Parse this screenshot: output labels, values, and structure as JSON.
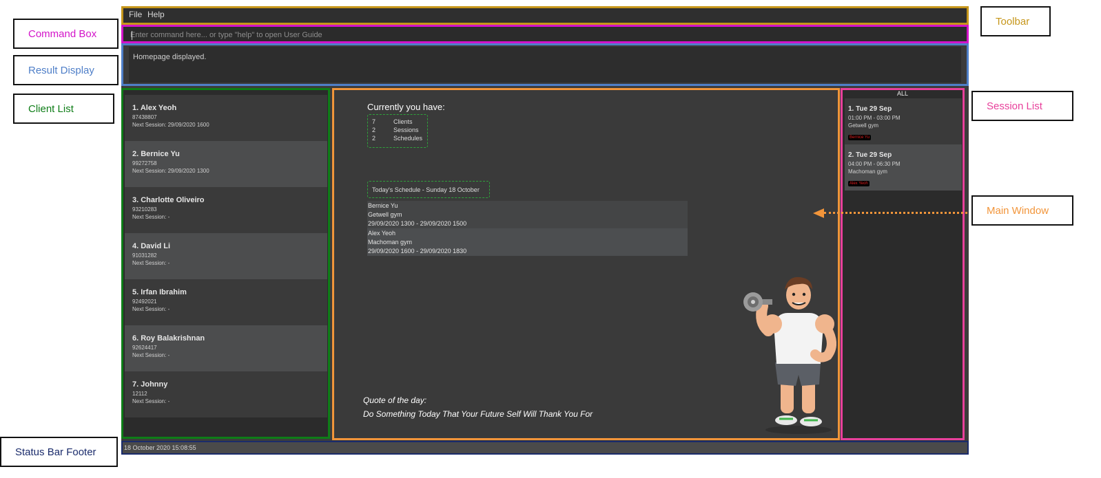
{
  "toolbar": {
    "menu": [
      "File",
      "Help"
    ]
  },
  "command_box": {
    "placeholder": "Enter command here... or type \"help\" to open User Guide",
    "value": ""
  },
  "result_display": {
    "text": "Homepage displayed."
  },
  "client_list": {
    "items": [
      {
        "name": "1.  Alex Yeoh",
        "phone": "87438807",
        "next": "Next Session: 29/09/2020 1600"
      },
      {
        "name": "2.  Bernice Yu",
        "phone": "99272758",
        "next": "Next Session: 29/09/2020 1300"
      },
      {
        "name": "3.  Charlotte Oliveiro",
        "phone": "93210283",
        "next": "Next Session:  -"
      },
      {
        "name": "4.  David Li",
        "phone": "91031282",
        "next": "Next Session:  -"
      },
      {
        "name": "5.  Irfan Ibrahim",
        "phone": "92492021",
        "next": "Next Session:  -"
      },
      {
        "name": "6.  Roy Balakrishnan",
        "phone": "92624417",
        "next": "Next Session:  -"
      },
      {
        "name": "7.  Johnny",
        "phone": "12112",
        "next": "Next Session:  -"
      }
    ]
  },
  "main_window": {
    "summary_title": "Currently you have:",
    "summary": [
      {
        "count": "7",
        "label": "Clients"
      },
      {
        "count": "2",
        "label": "Sessions"
      },
      {
        "count": "2",
        "label": "Schedules"
      }
    ],
    "schedule_title": "Today's Schedule - Sunday 18 October",
    "schedules": [
      {
        "client": "Bernice Yu",
        "gym": "Getwell gym",
        "time": "29/09/2020 1300 - 29/09/2020 1500"
      },
      {
        "client": "Alex Yeoh",
        "gym": "Machoman gym",
        "time": "29/09/2020 1600 - 29/09/2020 1830"
      }
    ],
    "quote_title": "Quote of the day:",
    "quote_text": "Do Something Today That Your Future Self Will Thank You For"
  },
  "session_list": {
    "filter": "ALL",
    "items": [
      {
        "title": "1.  Tue 29 Sep",
        "time": "01:00 PM - 03:00 PM",
        "gym": "Getwell gym",
        "client_tag": "Bernice Yu"
      },
      {
        "title": "2.  Tue 29 Sep",
        "time": "04:00 PM - 06:30 PM",
        "gym": "Machoman gym",
        "client_tag": "Alex Yeoh"
      }
    ]
  },
  "status_bar": {
    "text": "18 October 2020 15:08:55"
  },
  "annotations": {
    "toolbar": "Toolbar",
    "command_box": "Command Box",
    "result_display": "Result Display",
    "client_list": "Client List",
    "session_list": "Session List",
    "main_window": "Main Window",
    "status_bar": "Status Bar Footer"
  },
  "colors": {
    "toolbar": "#c6961a",
    "command_box": "#d313c9",
    "result_display": "#4f7fc8",
    "client_list": "#0e7d17",
    "main_window": "#f2953a",
    "session_list": "#e8409b",
    "status_bar": "#1a2b6b"
  }
}
